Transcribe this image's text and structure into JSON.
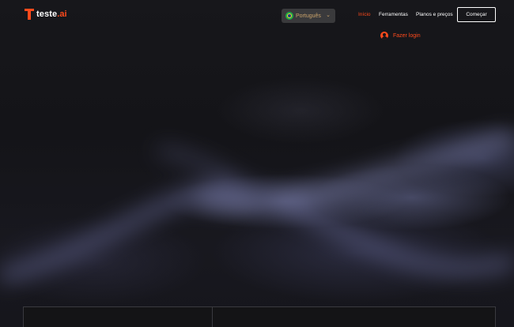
{
  "brand": {
    "name_main": "teste",
    "name_accent": ".ai",
    "accent_color": "#ff4a1c"
  },
  "language": {
    "selected": "Português",
    "flag_icon": "brazil-flag-icon",
    "chevron_icon": "chevron-down-icon"
  },
  "nav": {
    "items": [
      {
        "label": "Início",
        "active": true
      },
      {
        "label": "Ferramentas",
        "active": false
      },
      {
        "label": "Planos e preços",
        "active": false
      }
    ],
    "cta_label": "Começar"
  },
  "login": {
    "label": "Fazer login",
    "icon": "user-avatar-icon"
  },
  "theme": {
    "background": "#141418",
    "accent": "#ff4a1c",
    "text": "#ffffff"
  }
}
